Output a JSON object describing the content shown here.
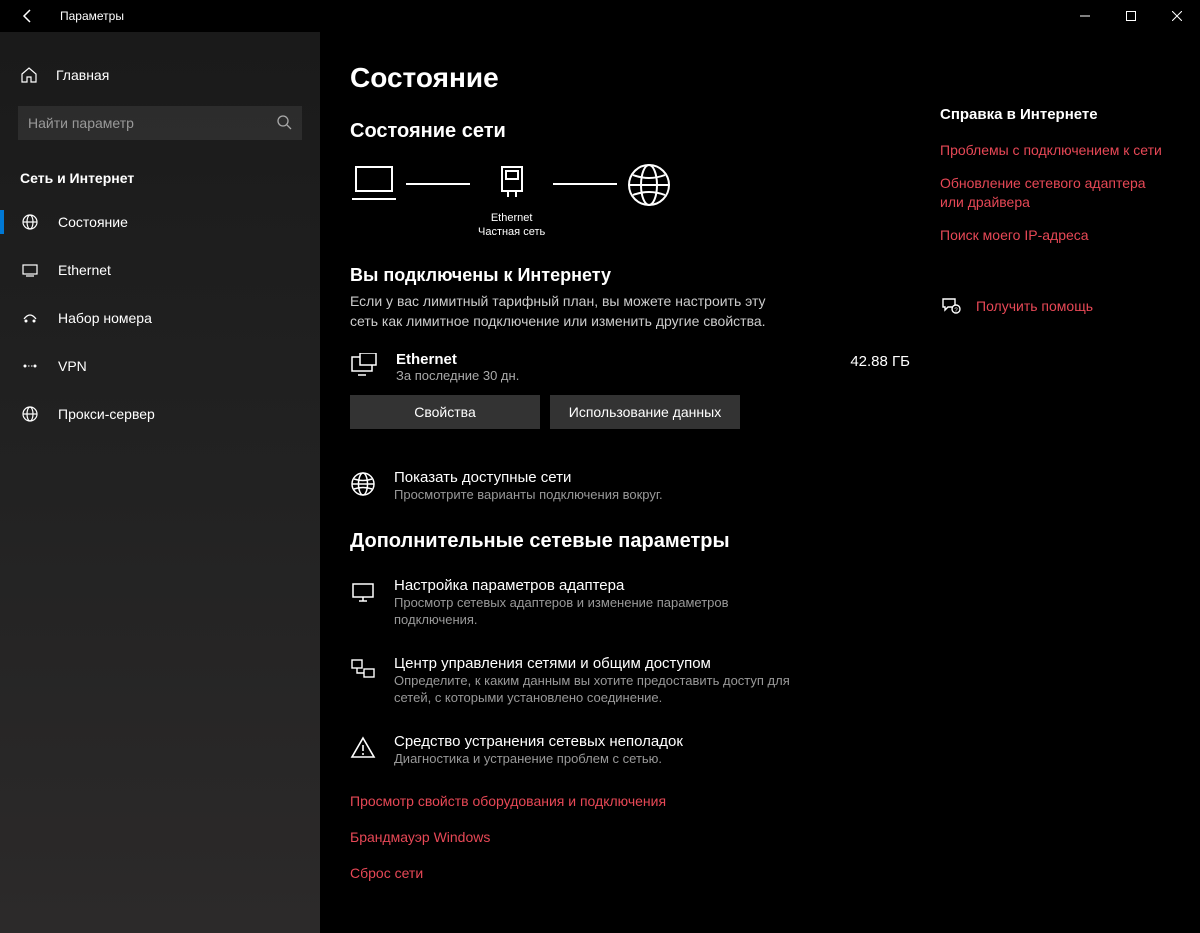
{
  "titlebar": {
    "title": "Параметры"
  },
  "sidebar": {
    "home": "Главная",
    "search_placeholder": "Найти параметр",
    "section_title": "Сеть и Интернет",
    "items": [
      {
        "label": "Состояние",
        "active": true
      },
      {
        "label": "Ethernet",
        "active": false
      },
      {
        "label": "Набор номера",
        "active": false
      },
      {
        "label": "VPN",
        "active": false
      },
      {
        "label": "Прокси-сервер",
        "active": false
      }
    ]
  },
  "page": {
    "title": "Состояние",
    "net_status_heading": "Состояние сети",
    "diagram": {
      "mid_label1": "Ethernet",
      "mid_label2": "Частная сеть"
    },
    "connected_title": "Вы подключены к Интернету",
    "connected_desc": "Если у вас лимитный тарифный план, вы можете настроить эту сеть как лимитное подключение или изменить другие свойства.",
    "connection": {
      "name": "Ethernet",
      "sub": "За последние 30 дн.",
      "usage": "42.88 ГБ",
      "props_btn": "Свойства",
      "usage_btn": "Использование данных"
    },
    "available": {
      "title": "Показать доступные сети",
      "desc": "Просмотрите варианты подключения вокруг."
    },
    "advanced_heading": "Дополнительные сетевые параметры",
    "adapter": {
      "title": "Настройка параметров адаптера",
      "desc": "Просмотр сетевых адаптеров и изменение параметров подключения."
    },
    "sharing": {
      "title": "Центр управления сетями и общим доступом",
      "desc": "Определите, к каким данным вы хотите предоставить доступ для сетей, с которыми установлено соединение."
    },
    "troubleshoot": {
      "title": "Средство устранения сетевых неполадок",
      "desc": "Диагностика и устранение проблем с сетью."
    },
    "red_links": [
      "Просмотр свойств оборудования и подключения",
      "Брандмауэр Windows",
      "Сброс сети"
    ]
  },
  "help": {
    "header": "Справка в Интернете",
    "links": [
      "Проблемы с подключением к сети",
      "Обновление сетевого адаптера или драйвера",
      "Поиск моего IP-адреса"
    ],
    "get_help": "Получить помощь"
  }
}
